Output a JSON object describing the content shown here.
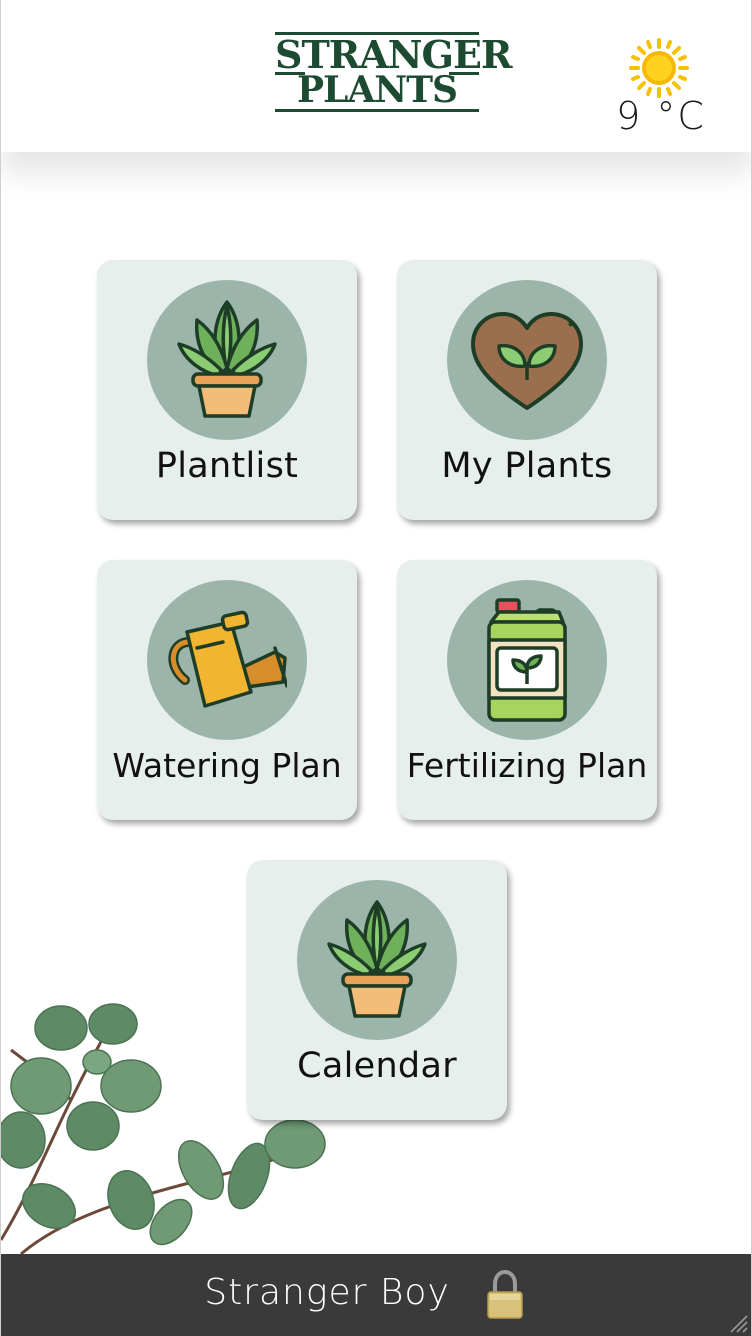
{
  "header": {
    "logo_line1": "STRANGER",
    "logo_line2": "PLANTS",
    "weather_icon": "sun-icon",
    "temperature": "9 °C"
  },
  "menu": [
    {
      "id": "plantlist",
      "label": "Plantlist",
      "icon": "potted-plant-icon"
    },
    {
      "id": "my-plants",
      "label": "My Plants",
      "icon": "heart-plant-icon"
    },
    {
      "id": "watering",
      "label": "Watering Plan",
      "icon": "watering-can-icon"
    },
    {
      "id": "fertilizing",
      "label": "Fertilizing Plan",
      "icon": "fertilizer-bottle-icon"
    },
    {
      "id": "calendar",
      "label": "Calendar",
      "icon": "potted-plant-icon"
    }
  ],
  "footer": {
    "user_name": "Stranger Boy",
    "lock_icon": "lock-icon"
  },
  "colors": {
    "brand_green": "#1d4b32",
    "card_bg": "#e6efec",
    "icon_disc": "#9cb5ab",
    "footer_bg": "#3a3a3a"
  }
}
